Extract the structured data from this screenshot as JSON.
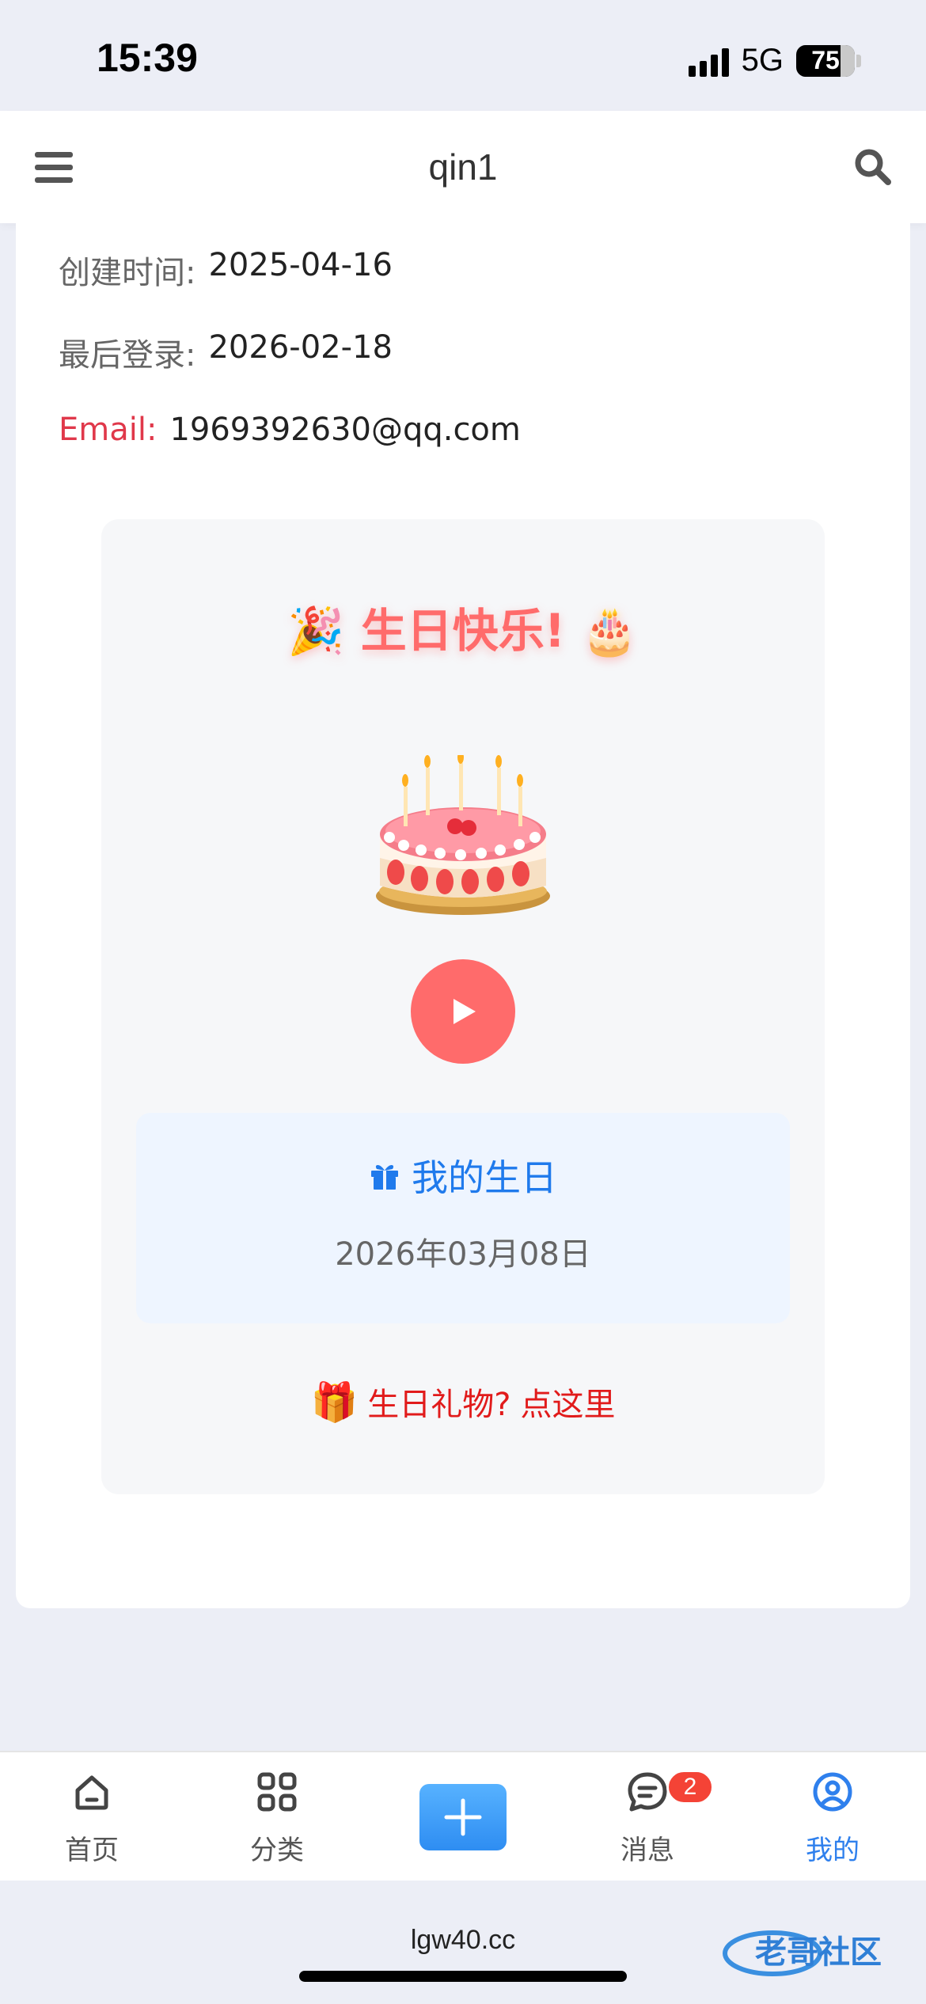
{
  "status_bar": {
    "time": "15:39",
    "network": "5G",
    "battery": "75"
  },
  "header": {
    "title": "qin1",
    "menu_icon": "menu-icon",
    "search_icon": "search-icon"
  },
  "profile": {
    "created_label": "创建时间:",
    "created_value": "2025-04-16",
    "last_login_label": "最后登录:",
    "last_login_value": "2026-02-18",
    "email_label": "Email:",
    "email_value": "1969392630@qq.com"
  },
  "birthday": {
    "title": "🎉 生日快乐! 🎂",
    "cake_icon": "birthday-cake-icon",
    "play_icon": "play-icon",
    "my_birthday_label": "我的生日",
    "my_birthday_date": "2026年03月08日",
    "gift_text": "生日礼物?",
    "gift_link": "点这里",
    "accent_color": "#ff6b6b"
  },
  "tabbar": {
    "tabs": [
      {
        "label": "首页",
        "icon": "home-icon"
      },
      {
        "label": "分类",
        "icon": "grid-icon"
      },
      {
        "label": "",
        "icon": "plus-icon"
      },
      {
        "label": "消息",
        "icon": "message-icon",
        "badge": "2"
      },
      {
        "label": "我的",
        "icon": "user-icon",
        "active": true
      }
    ]
  },
  "browser": {
    "url": "lgw40.cc",
    "watermark": "老哥社区"
  }
}
